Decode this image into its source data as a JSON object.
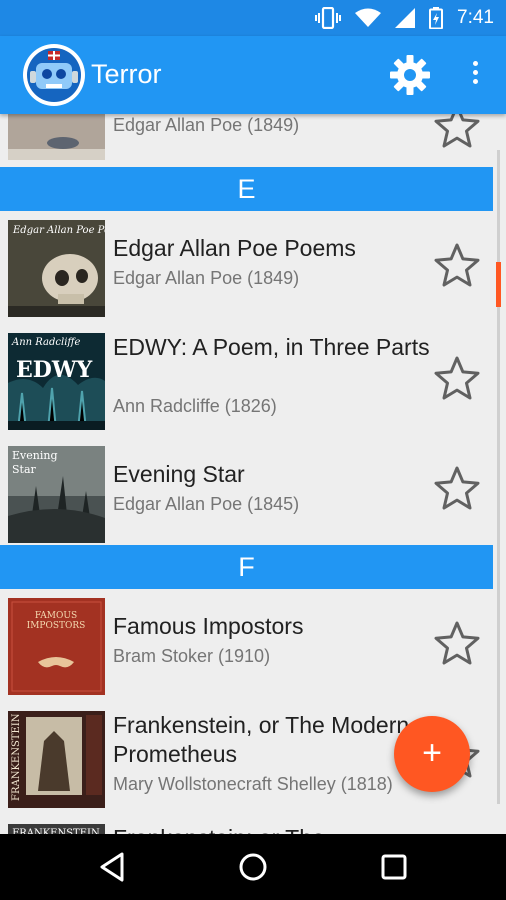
{
  "status_bar": {
    "time": "7:41"
  },
  "app_bar": {
    "title": "Terror"
  },
  "list": {
    "partial_top": {
      "meta": "Edgar Allan Poe (1849)"
    },
    "sections": [
      {
        "letter": "E",
        "books": [
          {
            "title": "Edgar Allan Poe Poems",
            "meta": "Edgar Allan Poe (1849)",
            "cover_text": "Edgar Allan Poe Poems"
          },
          {
            "title": "EDWY: A Poem, in Three Parts",
            "meta": "Ann Radcliffe (1826)",
            "cover_text": "Ann Radcliffe",
            "cover_title": "EDWY"
          },
          {
            "title": "Evening Star",
            "meta": "Edgar Allan Poe (1845)",
            "cover_text": "Evening Star"
          }
        ]
      },
      {
        "letter": "F",
        "books": [
          {
            "title": "Famous Impostors",
            "meta": "Bram Stoker (1910)",
            "cover_text": "FAMOUS IMPOSTORS"
          },
          {
            "title": "Frankenstein, or The Modern Prometheus",
            "meta": "Mary Wollstonecraft Shelley (1818)",
            "cover_text": "FRANKENSTEIN"
          },
          {
            "title": "Frankenstein; or The",
            "meta": "",
            "cover_text": "FRANKENSTEIN"
          }
        ]
      }
    ]
  },
  "fab": {
    "label": "+"
  },
  "colors": {
    "primary": "#2196f3",
    "status": "#1e88e5",
    "accent": "#ff5722",
    "nav": "#000000"
  },
  "icons": [
    "vibrate-icon",
    "wifi-icon",
    "signal-icon",
    "battery-charging-icon",
    "gear-icon",
    "overflow-menu-icon",
    "star-outline-icon",
    "back-icon",
    "home-icon",
    "recents-icon"
  ]
}
